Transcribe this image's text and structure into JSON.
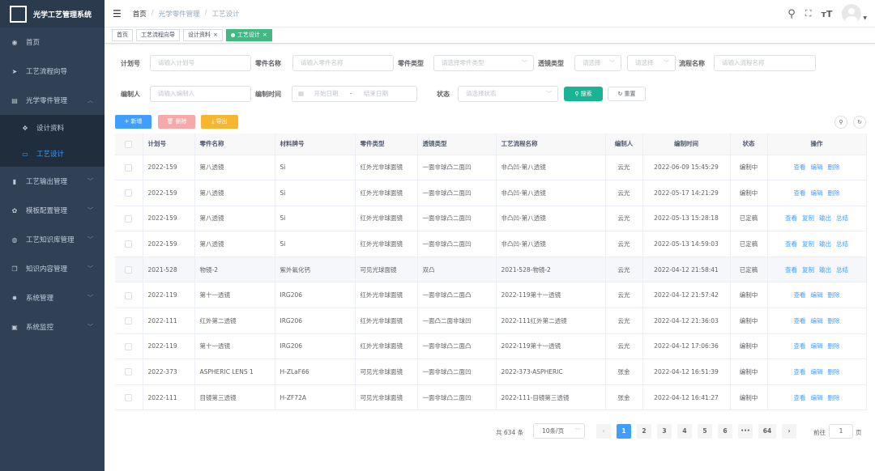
{
  "app": {
    "title": "光学工艺管理系统"
  },
  "sidebar": {
    "items": [
      {
        "label": "首页",
        "icon": "dashboard-icon"
      },
      {
        "label": "工艺流程向导",
        "icon": "send-icon"
      },
      {
        "label": "光学零件管理",
        "icon": "doc-icon",
        "expanded": true,
        "children": [
          {
            "label": "设计资料",
            "icon": "puzzle-icon"
          },
          {
            "label": "工艺设计",
            "icon": "monitor-icon",
            "active": true
          }
        ]
      },
      {
        "label": "工艺输出管理",
        "icon": "chart-icon"
      },
      {
        "label": "模板配置管理",
        "icon": "gear-icon"
      },
      {
        "label": "工艺知识库管理",
        "icon": "compass-icon"
      },
      {
        "label": "知识内容管理",
        "icon": "copy-icon"
      },
      {
        "label": "系统管理",
        "icon": "settings-icon"
      },
      {
        "label": "系统监控",
        "icon": "screen-icon"
      }
    ]
  },
  "header": {
    "breadcrumb": [
      "首页",
      "光学零件管理",
      "工艺设计"
    ],
    "sep": "/"
  },
  "tags": [
    "首页",
    "工艺流程向导",
    "设计资料",
    "工艺设计"
  ],
  "filters": {
    "plan_no": {
      "label": "计划号",
      "placeholder": "请输入计划号"
    },
    "part_name": {
      "label": "零件名称",
      "placeholder": "请输入零件名称"
    },
    "part_type": {
      "label": "零件类型",
      "placeholder": "请选择零件类型"
    },
    "lens_type": {
      "label": "透镜类型",
      "placeholder1": "请选择",
      "placeholder2": "请选择"
    },
    "flow_name": {
      "label": "流程名称",
      "placeholder": "请输入流程名称"
    },
    "author": {
      "label": "编制人",
      "placeholder": "请输入编制人"
    },
    "date": {
      "label": "编制时间",
      "start": "开始日期",
      "dash": "-",
      "end": "结束日期"
    },
    "status": {
      "label": "状态",
      "placeholder": "请选择状态"
    },
    "search_btn": "搜索",
    "reset_btn": "重置"
  },
  "toolbar": {
    "add": "+ 新增",
    "delete": "删除",
    "export": "导出"
  },
  "table": {
    "columns": [
      "计划号",
      "零件名称",
      "材料牌号",
      "零件类型",
      "透镜类型",
      "工艺流程名称",
      "编制人",
      "编制时间",
      "状态",
      "操作"
    ],
    "rows": [
      {
        "plan": "2022-159",
        "name": "第八透镜",
        "mat": "Si",
        "ptype": "红外光非球面镜",
        "ltype": "一面非球凸二面凹",
        "flow": "非凸凹-第八透镜",
        "author": "云光",
        "time": "2022-06-09 15:45:29",
        "status": "编制中",
        "ops": [
          "查看",
          "编辑",
          "删除"
        ]
      },
      {
        "plan": "2022-159",
        "name": "第八透镜",
        "mat": "Si",
        "ptype": "红外光非球面镜",
        "ltype": "一面非球凸二面凹",
        "flow": "非凸凹-第八透镜",
        "author": "云光",
        "time": "2022-05-17 14:21:29",
        "status": "编制中",
        "ops": [
          "查看",
          "编辑",
          "删除"
        ]
      },
      {
        "plan": "2022-159",
        "name": "第八透镜",
        "mat": "Si",
        "ptype": "红外光非球面镜",
        "ltype": "一面非球凸二面凹",
        "flow": "非凸凹-第八透镜",
        "author": "云光",
        "time": "2022-05-13 15:28:18",
        "status": "已定稿",
        "ops": [
          "查看",
          "复制",
          "输出",
          "总结"
        ]
      },
      {
        "plan": "2022-159",
        "name": "第八透镜",
        "mat": "Si",
        "ptype": "红外光非球面镜",
        "ltype": "一面非球凸二面凹",
        "flow": "非凸凹-第八透镜",
        "author": "云光",
        "time": "2022-05-13 14:59:03",
        "status": "已定稿",
        "ops": [
          "查看",
          "复制",
          "输出",
          "总结"
        ]
      },
      {
        "plan": "2021-528",
        "name": "物镜-2",
        "mat": "紫外氟化钙",
        "ptype": "可见光球面镜",
        "ltype": "双凸",
        "flow": "2021-528-物镜-2",
        "author": "云光",
        "time": "2022-04-12 21:58:41",
        "status": "已定稿",
        "ops": [
          "查看",
          "复制",
          "输出",
          "总结"
        ]
      },
      {
        "plan": "2022-119",
        "name": "第十一透镜",
        "mat": "IRG206",
        "ptype": "红外光非球面镜",
        "ltype": "一面非球凸二面凸",
        "flow": "2022-119第十一透镜",
        "author": "云光",
        "time": "2022-04-12 21:57:42",
        "status": "编制中",
        "ops": [
          "查看",
          "编辑",
          "删除"
        ]
      },
      {
        "plan": "2022-111",
        "name": "红外第二透镜",
        "mat": "IRG206",
        "ptype": "红外光非球面镜",
        "ltype": "一面凸二面非球凹",
        "flow": "2022-111红外第二透镜",
        "author": "云光",
        "time": "2022-04-12 21:36:03",
        "status": "编制中",
        "ops": [
          "查看",
          "编辑",
          "删除"
        ]
      },
      {
        "plan": "2022-119",
        "name": "第十一透镜",
        "mat": "IRG206",
        "ptype": "红外光非球面镜",
        "ltype": "一面非球凸二面凸",
        "flow": "2022-119第十一透镜",
        "author": "云光",
        "time": "2022-04-12 17:06:36",
        "status": "编制中",
        "ops": [
          "查看",
          "编辑",
          "删除"
        ]
      },
      {
        "plan": "2022-373",
        "name": "ASPHERIC LENS 1",
        "mat": "H-ZLaF66",
        "ptype": "可见光非球面镜",
        "ltype": "一面非球凸二面凹",
        "flow": "2022-373-ASPHERIC",
        "author": "张金",
        "time": "2022-04-12 16:51:39",
        "status": "编制中",
        "ops": [
          "查看",
          "编辑",
          "删除"
        ]
      },
      {
        "plan": "2022-111",
        "name": "目镜第三透镜",
        "mat": "H-ZF72A",
        "ptype": "可见光非球面镜",
        "ltype": "一面非球凸二面凹",
        "flow": "2022-111-目镜第三透镜",
        "author": "张金",
        "time": "2022-04-12 16:41:27",
        "status": "编制中",
        "ops": [
          "查看",
          "编辑",
          "删除"
        ]
      }
    ]
  },
  "pager": {
    "total": "共 634 条",
    "size": "10条/页",
    "pages": [
      "1",
      "2",
      "3",
      "4",
      "5",
      "6",
      "•••",
      "64"
    ],
    "current": "1",
    "goto_label": "前往",
    "goto_value": "1",
    "page_suffix": "页",
    "prev": "‹",
    "next": "›"
  }
}
